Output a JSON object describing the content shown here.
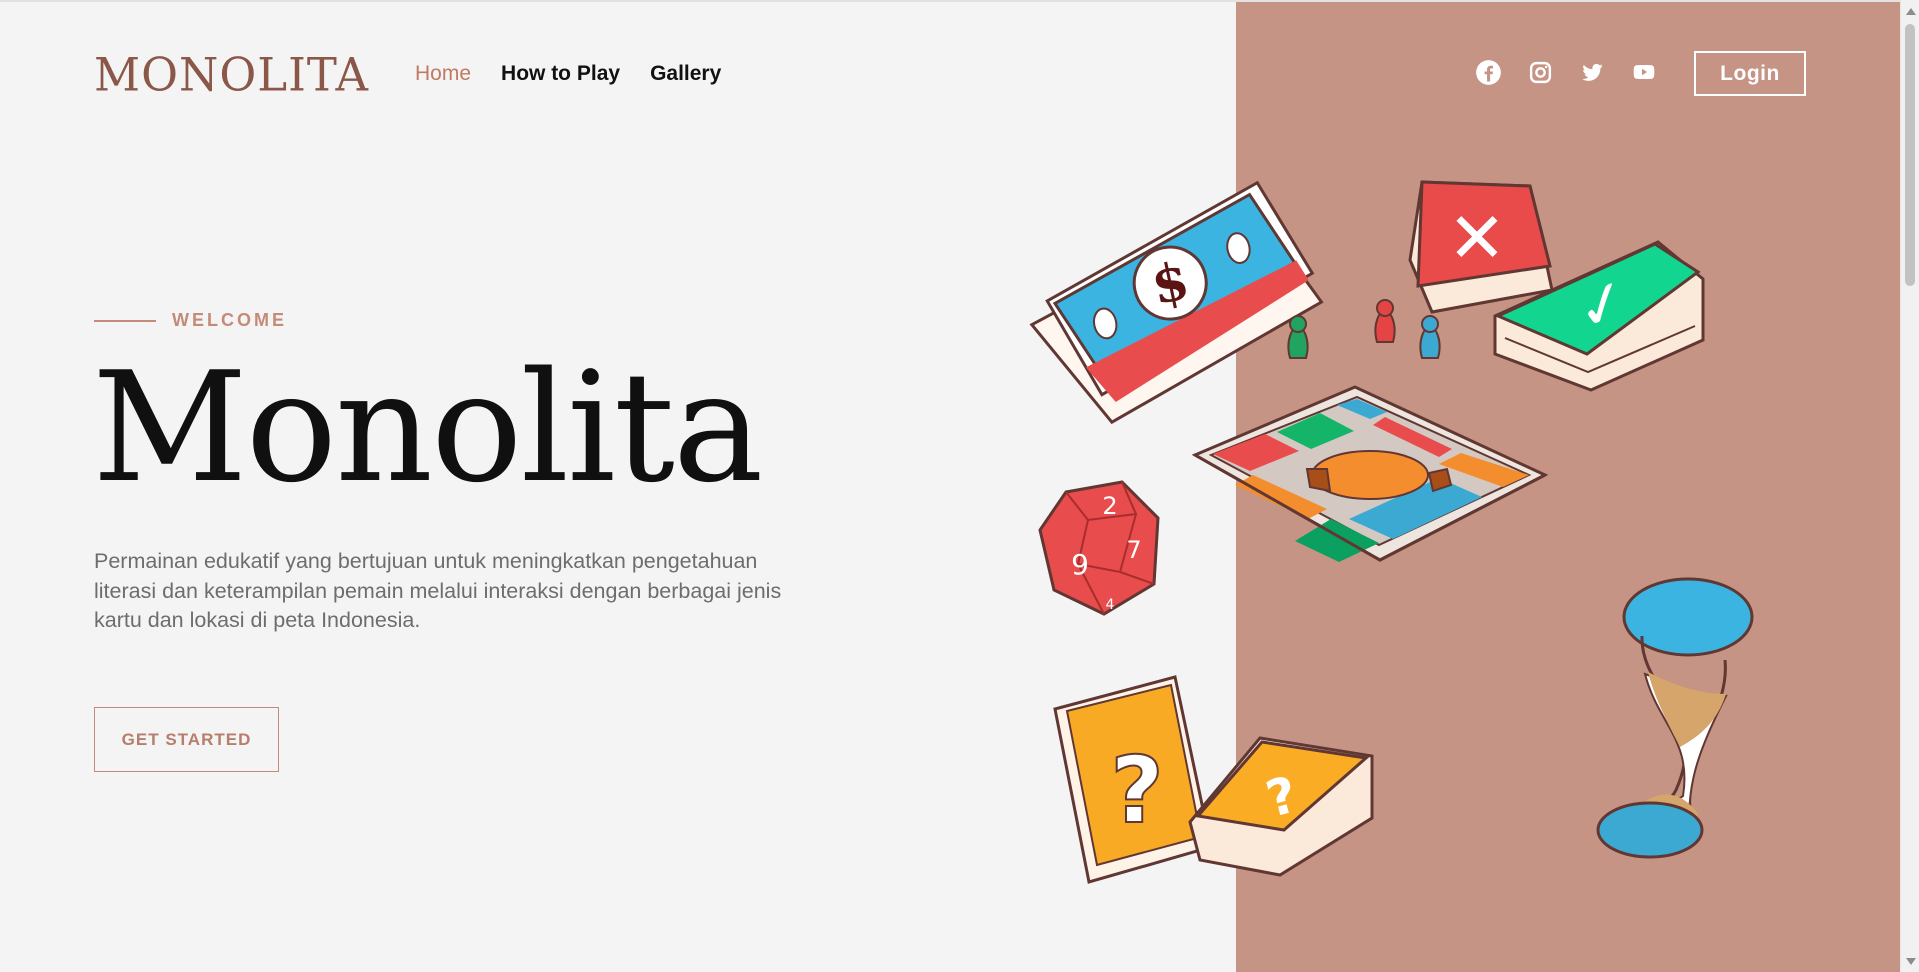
{
  "brand": {
    "name": "MONOLITA",
    "accent": "#c69484",
    "accent_text": "#c48b79",
    "background": "#f4f4f4"
  },
  "nav": {
    "items": [
      {
        "label": "Home",
        "active": true
      },
      {
        "label": "How to Play",
        "active": false
      },
      {
        "label": "Gallery",
        "active": false
      }
    ]
  },
  "social": {
    "icons": [
      "facebook-icon",
      "instagram-icon",
      "twitter-icon",
      "youtube-icon"
    ]
  },
  "login": {
    "label": "Login"
  },
  "hero": {
    "eyebrow": "WELCOME",
    "title": "Monolita",
    "description": "Permainan edukatif yang bertujuan untuk meningkatkan pengetahuan literasi dan keterampilan pemain melalui interaksi dengan berbagai jenis kartu dan lokasi di peta Indonesia.",
    "button": "GET STARTED"
  },
  "illustration": {
    "money_symbol": "$",
    "die_numbers": [
      "2",
      "7",
      "9",
      "4"
    ],
    "card_symbols": [
      "✕",
      "✓",
      "?",
      "?"
    ]
  }
}
